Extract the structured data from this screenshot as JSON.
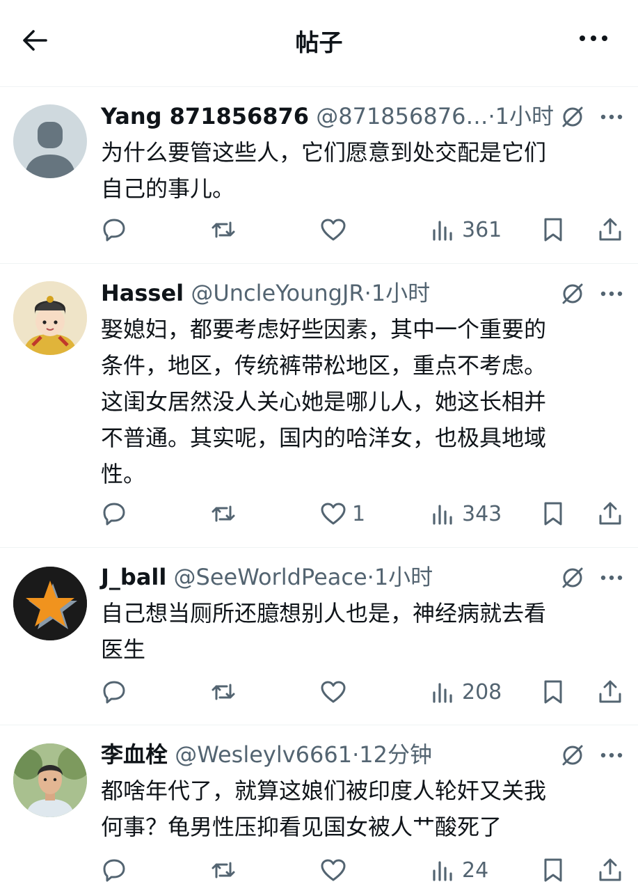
{
  "header": {
    "title": "帖子",
    "back_icon": "arrow-left-icon",
    "more_icon": "more-horizontal-icon"
  },
  "tweets": [
    {
      "name": "Yang 871856876",
      "handle": "@871856876…",
      "dot": "·",
      "time": "1小时",
      "lines": [
        "为什么要管这些人，它们愿意到处交配是它们",
        "自己的事儿。"
      ],
      "likes": "",
      "views": "361",
      "avatar": "default-avatar"
    },
    {
      "name": "Hassel",
      "handle": "@UncleYoungJR",
      "dot": "·",
      "time": "1小时",
      "lines": [
        "娶媳妇，都要考虑好些因素，其中一个重要的",
        "条件，地区，传统裤带松地区，重点不考虑。",
        "这闺女居然没人关心她是哪儿人，她这长相并",
        "不普通。其实呢，国内的哈洋女，也极具地域",
        "性。"
      ],
      "likes": "1",
      "views": "343",
      "avatar": "cartoon-emperor-avatar"
    },
    {
      "name": "J_ball",
      "handle": "@SeeWorldPeace",
      "dot": "·",
      "time": "1小时",
      "lines": [
        "自己想当厕所还臆想别人也是，神经病就去看",
        "医生"
      ],
      "likes": "",
      "views": "208",
      "avatar": "star-avatar"
    },
    {
      "name": "李血栓",
      "handle": "@Wesleylv6661",
      "dot": "·",
      "time": "12分钟",
      "lines": [
        "都啥年代了，就算这娘们被印度人轮奸又关我",
        "何事？龟男性压抑看见国女被人艹酸死了"
      ],
      "likes": "",
      "views": "24",
      "avatar": "illustrated-man-avatar"
    }
  ],
  "colors": {
    "text": "#0f1419",
    "secondary": "#536471",
    "divider": "#eff3f4",
    "avatar_placeholder": "#cfd9de"
  }
}
